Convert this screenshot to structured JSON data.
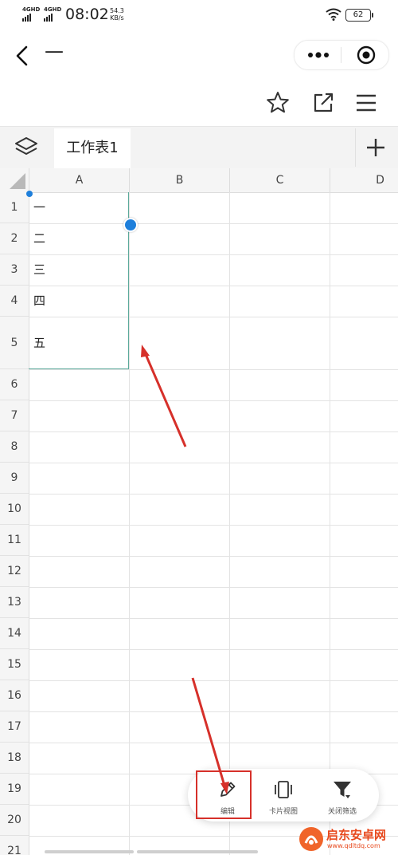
{
  "status_bar": {
    "signal1": "4GHD",
    "signal2": "4GHD",
    "time": "08:02",
    "speed_value": "54.3",
    "speed_unit": "KB/s",
    "battery": "62"
  },
  "nav": {
    "back_icon": "chevron-left-icon",
    "title": "—",
    "more_icon": "more-dots-icon",
    "close_icon": "target-close-icon"
  },
  "toolbar": {
    "icons": [
      "star-icon",
      "share-external-icon",
      "menu-icon"
    ]
  },
  "sheet_bar": {
    "layers_icon": "layers-icon",
    "active_sheet": "工作表1",
    "add_icon": "plus-icon"
  },
  "grid": {
    "columns": [
      "A",
      "B",
      "C",
      "D"
    ],
    "rows": [
      "1",
      "2",
      "3",
      "4",
      "5",
      "6",
      "7",
      "8",
      "9",
      "10",
      "11",
      "12",
      "13",
      "14",
      "15",
      "16",
      "17",
      "18",
      "19",
      "20",
      "21"
    ],
    "cells_col_a": [
      "一",
      "二",
      "三",
      "四",
      "五"
    ]
  },
  "bottom_toolbar": {
    "edit_label": "编辑",
    "card_view_label": "卡片视图",
    "close_filter_label": "关闭筛选"
  },
  "watermark": {
    "brand_cn": "启东安卓网",
    "brand_url": "www.qdltdq.com"
  },
  "colors": {
    "accent": "#1e7fdb",
    "selection": "#5aa99a",
    "annotation": "#d6302a"
  }
}
